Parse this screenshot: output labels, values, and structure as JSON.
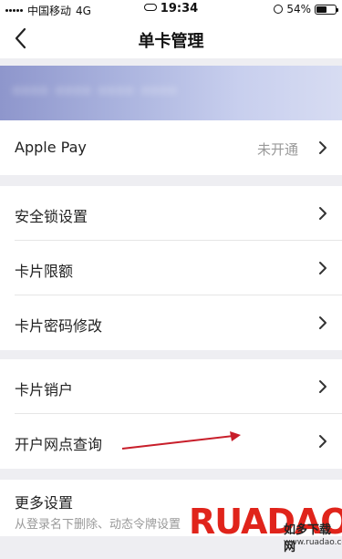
{
  "status_bar": {
    "carrier": "中国移动",
    "network": "4G",
    "time": "19:34",
    "battery": "54%",
    "battery_level": 0.54
  },
  "nav": {
    "title": "单卡管理",
    "back_icon": "chevron-left-icon"
  },
  "card": {
    "number_masked": "**** **** **** ****"
  },
  "apple_pay": {
    "label": "Apple Pay",
    "value": "未开通"
  },
  "group_security": [
    {
      "label": "安全锁设置"
    },
    {
      "label": "卡片限额"
    },
    {
      "label": "卡片密码修改"
    }
  ],
  "group_service": [
    {
      "label": "卡片销户"
    },
    {
      "label": "开户网点查询"
    }
  ],
  "more": {
    "label": "更多设置",
    "subtitle": "从登录名下删除、动态令牌设置"
  },
  "watermark": {
    "brand": "RUADAO",
    "tagline": "如多下载网",
    "url": "www.ruadao.com"
  },
  "colors": {
    "accent_banner": "#8e96cc",
    "annotation_arrow": "#c81e2a",
    "watermark_red": "#e0241b"
  }
}
